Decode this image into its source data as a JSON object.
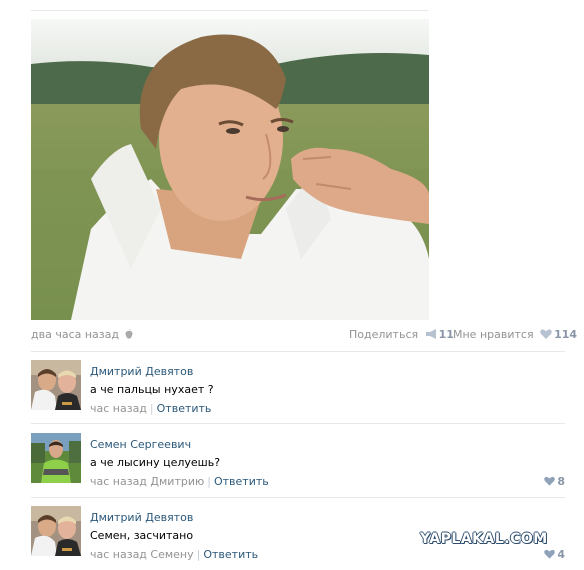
{
  "post": {
    "time": "два часа назад",
    "share_label": "Поделиться",
    "share_count": "11",
    "like_label": "Мне нравится",
    "like_count": "114"
  },
  "comments": [
    {
      "author": "Дмитрий Девятов",
      "text": "а че пальцы нухает ?",
      "time": "час назад",
      "reply_label": "Ответить",
      "likes": ""
    },
    {
      "author": "Семен Сергеевич",
      "text": "а че лысину целуешь?",
      "time": "час назад Дмитрию",
      "reply_label": "Ответить",
      "likes": "8"
    },
    {
      "author": "Дмитрий Девятов",
      "text": "Семен, засчитано",
      "time": "час назад Семену",
      "reply_label": "Ответить",
      "likes": "4"
    }
  ],
  "watermark": "YAPLAKAL.COM",
  "icons": {
    "post_source": "phone-icon",
    "share": "megaphone-icon",
    "like": "heart-icon"
  },
  "colors": {
    "link": "#2b587a",
    "meta": "#939393",
    "count": "#8a96a8"
  }
}
